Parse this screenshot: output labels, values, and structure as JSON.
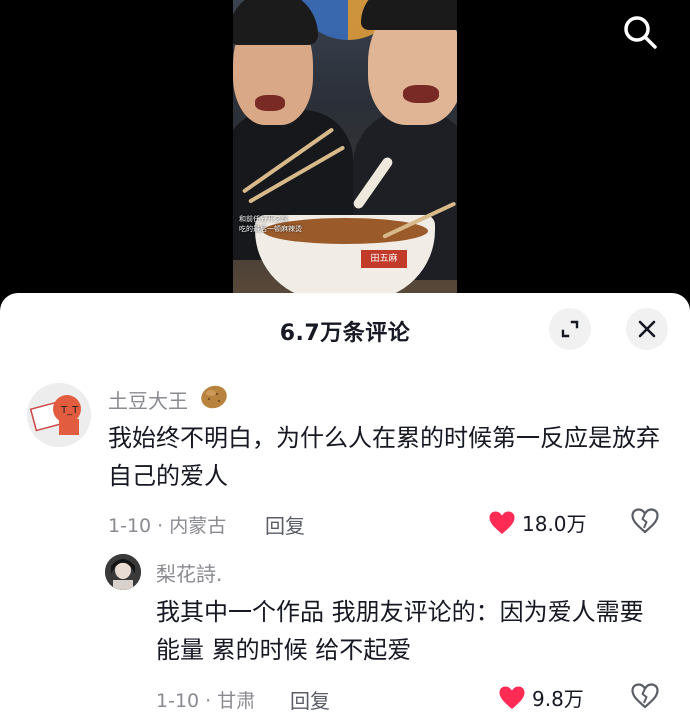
{
  "video": {
    "caption_line1": "和前任分开之前",
    "caption_line2": "吃的最后一顿麻辣烫",
    "bowl_label": "田五麻"
  },
  "icons": {
    "search": "search-icon",
    "expand": "expand-icon",
    "close": "close-icon",
    "like": "heart-icon",
    "dislike": "broken-heart-icon",
    "badge": "potato-icon"
  },
  "colors": {
    "like_red": "#fe2c55",
    "meta_gray": "#8a8b91",
    "text_dark": "#161823"
  },
  "comments_sheet": {
    "title": "6.7万条评论",
    "comments": [
      {
        "username": "土豆大王",
        "text": "我始终不明白，为什么人在累的时候第一反应是放弃自己的爱人",
        "date_location": "1-10 · 内蒙古",
        "reply_label": "回复",
        "likes": "18.0万",
        "replies": [
          {
            "username": "梨花詩.",
            "text": "我其中一个作品 我朋友评论的：因为爱人需要能量 累的时候 给不起爱",
            "date_location": "1-10 · 甘肃",
            "reply_label": "回复",
            "likes": "9.8万"
          }
        ]
      }
    ]
  }
}
